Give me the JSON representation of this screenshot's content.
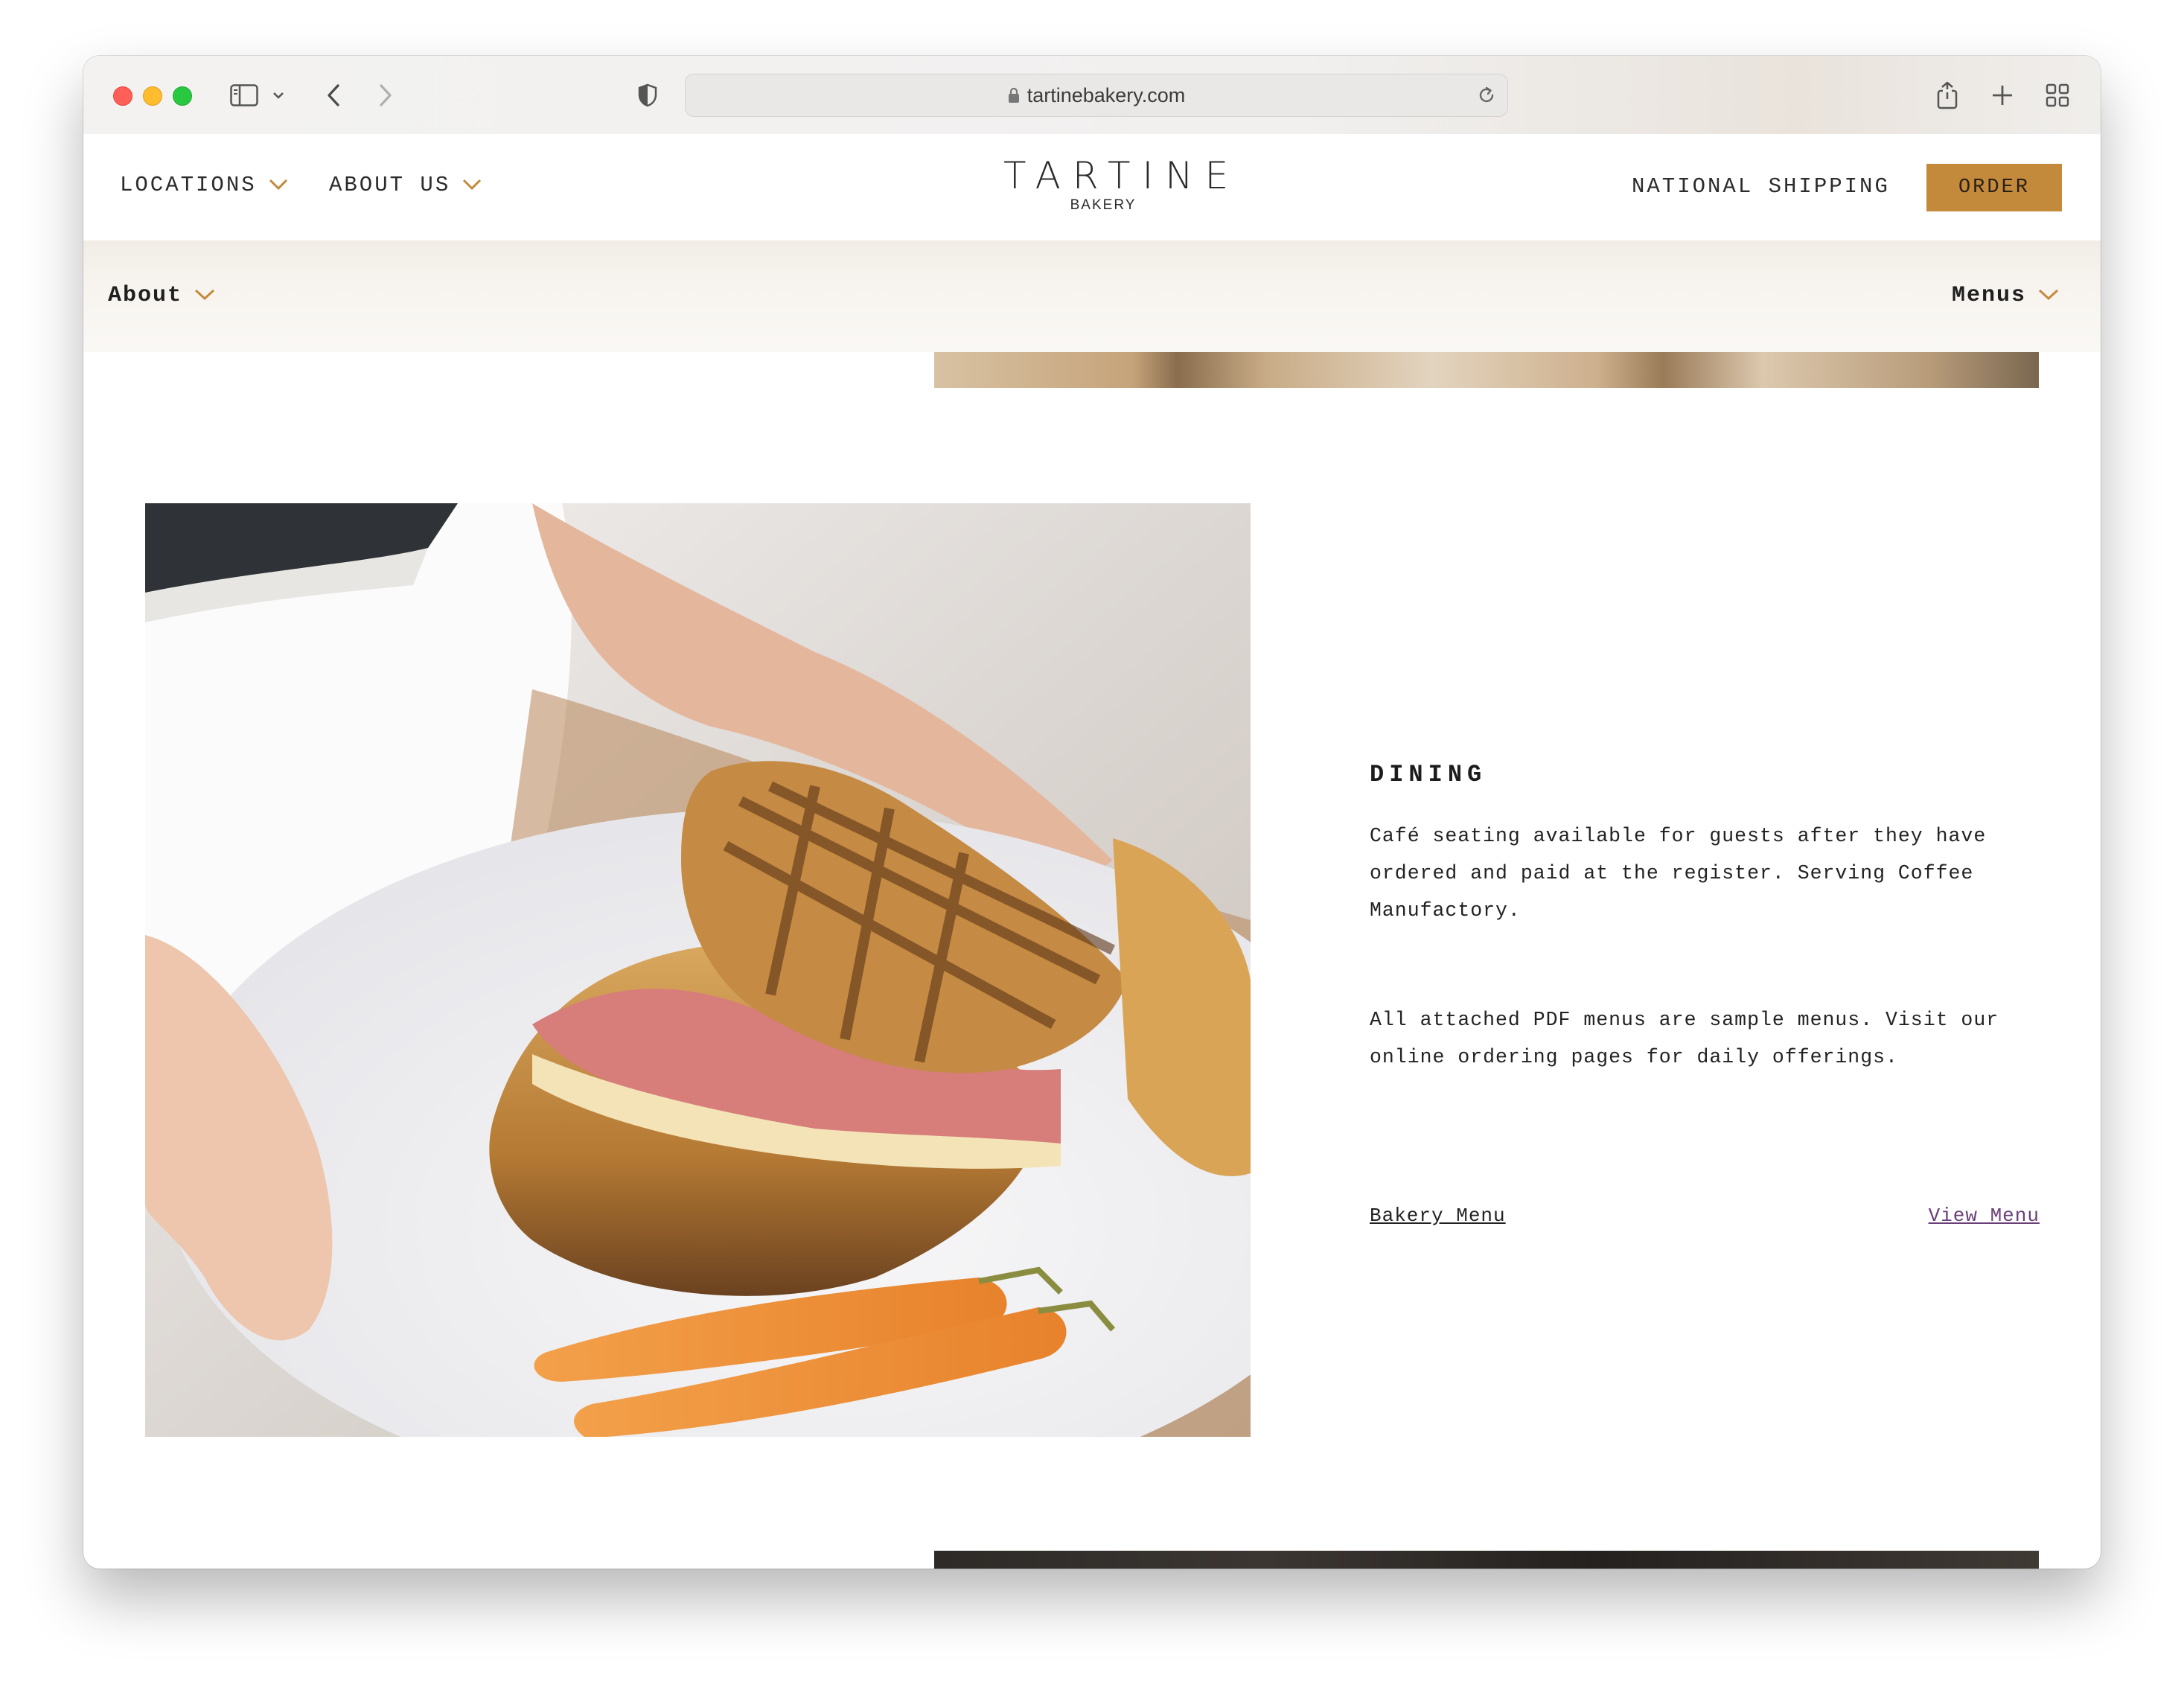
{
  "browser": {
    "url": "tartinebakery.com"
  },
  "header": {
    "locations_label": "LOCATIONS",
    "about_us_label": "ABOUT US",
    "logo_main": "TARTINE",
    "logo_sub": "BAKERY",
    "national_shipping_label": "NATIONAL SHIPPING",
    "order_label": "ORDER"
  },
  "subnav": {
    "about_label": "About",
    "menus_label": "Menus"
  },
  "dining": {
    "title": "DINING",
    "paragraph1": "Café seating available for guests after they have ordered and paid at the register. Serving Coffee Manufactory.",
    "paragraph2": "All attached PDF menus are sample menus. Visit our online ordering pages for daily offerings.",
    "menu_name": "Bakery Menu",
    "view_menu_label": "View Menu"
  },
  "colors": {
    "accent": "#c48a3b",
    "link_visited": "#6a3f78",
    "subnav_bg": "#f7f4ef"
  },
  "icons": [
    "sidebar-icon",
    "chevron-down-icon",
    "back-icon",
    "forward-icon",
    "privacy-shield-icon",
    "lock-icon",
    "reload-icon",
    "share-icon",
    "new-tab-icon",
    "tab-overview-icon"
  ]
}
